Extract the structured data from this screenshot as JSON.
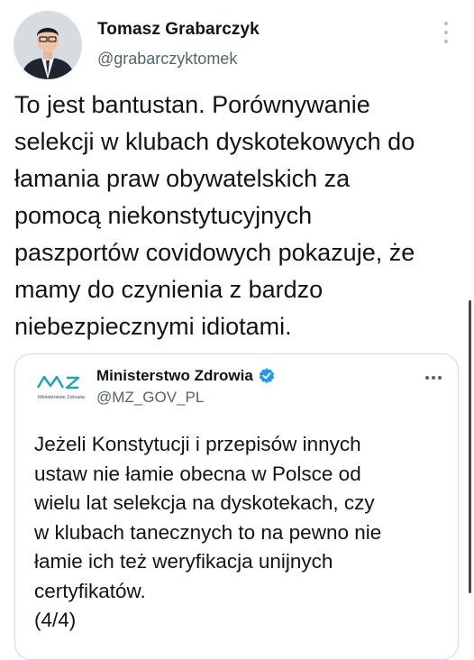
{
  "tweet": {
    "author": {
      "name": "Tomasz Grabarczyk",
      "handle": "@grabarczyktomek",
      "avatar_icon": "person-photo"
    },
    "text": "To jest bantustan. Porównywanie\nselekcji w klubach dyskotekowych do\nłamania praw obywatelskich za\npomocą niekonstytucyjnych\npaszportów covidowych pokazuje, że\nmamy do czynienia z bardzo\nniebezpiecznymi idiotami.",
    "more_icon": "more-vertical-icon"
  },
  "quoted_tweet": {
    "author": {
      "name": "Ministerstwo Zdrowia",
      "handle": "@MZ_GOV_PL",
      "logo_text": "Ministerstwo Zdrowia",
      "verified": true,
      "verified_color": "#1d9bf0"
    },
    "text": "Jeżeli Konstytucji i przepisów innych\nustaw nie łamie obecna w Polsce od\nwielu lat selekcja na dyskotekach, czy\nw klubach tanecznych to na pewno nie\nłamie ich też weryfikacja unijnych\ncertyfikatów.\n(4/4)",
    "more_icon": "more-horizontal-icon"
  },
  "colors": {
    "text": "#0f1419",
    "secondary": "#536471",
    "border": "#cfd9de",
    "logo_teal": "#1aa6b4"
  }
}
